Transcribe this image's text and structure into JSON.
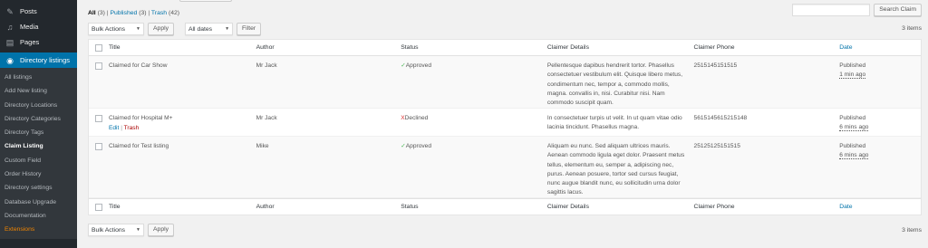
{
  "sidebar": {
    "top_items": [
      {
        "label": "Posts",
        "icon": "pushpin-icon"
      },
      {
        "label": "Media",
        "icon": "media-icon"
      },
      {
        "label": "Pages",
        "icon": "pages-icon"
      }
    ],
    "current": {
      "label": "Directory listings",
      "icon": "directory-icon"
    },
    "submenu": [
      "All listings",
      "Add New listing",
      "Directory Locations",
      "Directory Categories",
      "Directory Tags",
      "Claim Listing",
      "Custom Field",
      "Order History",
      "Directory settings",
      "Database Upgrade",
      "Documentation",
      "Extensions"
    ],
    "current_sub_index": 5
  },
  "views": {
    "all": "All",
    "all_count": "(3)",
    "published": "Published",
    "published_count": "(3)",
    "trash": "Trash",
    "trash_count": "(42)",
    "sep": "|"
  },
  "search": {
    "button": "Search Claim",
    "value": ""
  },
  "tablenav": {
    "bulk_actions": "Bulk Actions",
    "apply": "Apply",
    "all_dates": "All dates",
    "filter": "Filter",
    "items_count": "3 items"
  },
  "table": {
    "columns": {
      "title": "Title",
      "author": "Author",
      "status": "Status",
      "details": "Claimer Details",
      "phone": "Claimer Phone",
      "date": "Date"
    },
    "rows": [
      {
        "title": "Claimed for Car Show",
        "author": "Mr Jack",
        "status_mark": "✓",
        "status": "Approved",
        "details": "Pellentesque dapibus hendrerit tortor. Phasellus consectetuer vestibulum elit. Quisque libero metus, condimentum nec, tempor a, commodo mollis, magna. convallis in, nisi. Curabitur nisi. Nam commodo suscipit quam.",
        "phone": "2515145151515",
        "date_state": "Published",
        "date_ago": "1 min ago"
      },
      {
        "title": "Claimed for Hospital M+",
        "author": "Mr Jack",
        "status_mark": "X",
        "status": "Declined",
        "details": "In consectetuer turpis ut velit. In ut quam vitae odio lacinia tincidunt. Phasellus magna.",
        "phone": "5615145615215148",
        "date_state": "Published",
        "date_ago": "6 mins ago",
        "actions": {
          "edit": "Edit",
          "sep": "|",
          "trash": "Trash"
        }
      },
      {
        "title": "Claimed for Test listing",
        "author": "Mike",
        "status_mark": "✓",
        "status": "Approved",
        "details": "Aliquam eu nunc. Sed aliquam ultrices mauris. Aenean commodo ligula eget dolor. Praesent metus tellus, elementum eu, semper a, adipiscing nec, purus. Aenean posuere, tortor sed cursus feugiat, nunc augue blandit nunc, eu sollicitudin urna dolor sagittis lacus.",
        "phone": "25125125151515",
        "date_state": "Published",
        "date_ago": "6 mins ago"
      }
    ]
  }
}
